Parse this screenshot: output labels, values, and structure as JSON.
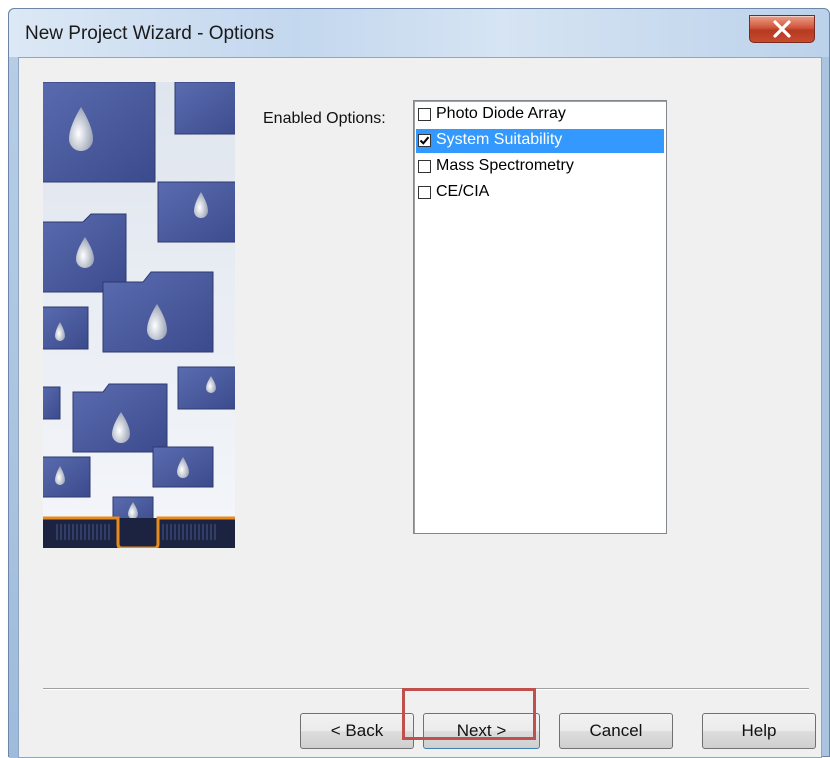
{
  "window": {
    "title": "New Project Wizard - Options",
    "close_icon": "close-icon"
  },
  "options": {
    "label": "Enabled Options:",
    "items": [
      {
        "label": "Photo Diode Array",
        "checked": false,
        "selected": false
      },
      {
        "label": "System Suitability",
        "checked": true,
        "selected": true
      },
      {
        "label": "Mass Spectrometry",
        "checked": false,
        "selected": false
      },
      {
        "label": "CE/CIA",
        "checked": false,
        "selected": false
      }
    ]
  },
  "buttons": {
    "back": "< Back",
    "next": "Next >",
    "cancel": "Cancel",
    "help": "Help"
  },
  "colors": {
    "selection": "#3399ff",
    "highlight_box": "#c0504d",
    "art_folder": "#4a5a9e"
  }
}
